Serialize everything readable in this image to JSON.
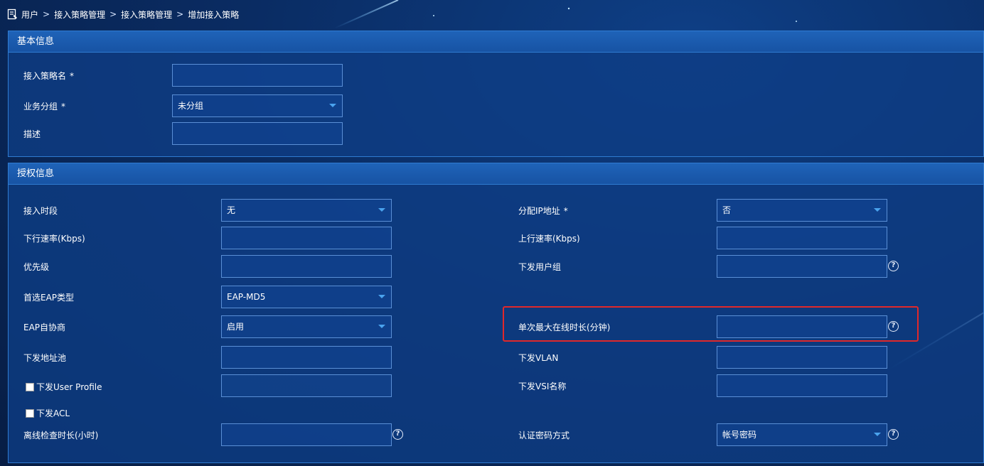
{
  "breadcrumb": [
    "用户",
    "接入策略管理",
    "接入策略管理",
    "增加接入策略"
  ],
  "breadcrumb_sep": ">",
  "basic": {
    "title": "基本信息",
    "policy_name_label": "接入策略名",
    "policy_name_value": "",
    "service_group_label": "业务分组",
    "service_group_value": "未分组",
    "description_label": "描述",
    "description_value": "",
    "required_mark": "*"
  },
  "auth": {
    "title": "授权信息",
    "access_period_label": "接入时段",
    "access_period_value": "无",
    "assign_ip_label": "分配IP地址",
    "assign_ip_value": "否",
    "downlink_rate_label": "下行速率(Kbps)",
    "uplink_rate_label": "上行速率(Kbps)",
    "priority_label": "优先级",
    "deploy_user_group_label": "下发用户组",
    "preferred_eap_label": "首选EAP类型",
    "preferred_eap_value": "EAP-MD5",
    "eap_autoneg_label": "EAP自协商",
    "eap_autoneg_value": "启用",
    "max_online_label": "单次最大在线时长(分钟)",
    "address_pool_label": "下发地址池",
    "deploy_vlan_label": "下发VLAN",
    "user_profile_label": "下发User Profile",
    "vsi_label": "下发VSI名称",
    "acl_label": "下发ACL",
    "offline_check_label": "离线检查时长(小时)",
    "auth_password_label": "认证密码方式",
    "auth_password_value": "帐号密码"
  },
  "icons": {
    "help": "?"
  },
  "colors": {
    "highlight": "#e0282a",
    "panel_border": "#2f7bd1",
    "header_bg": "#1753a4"
  }
}
